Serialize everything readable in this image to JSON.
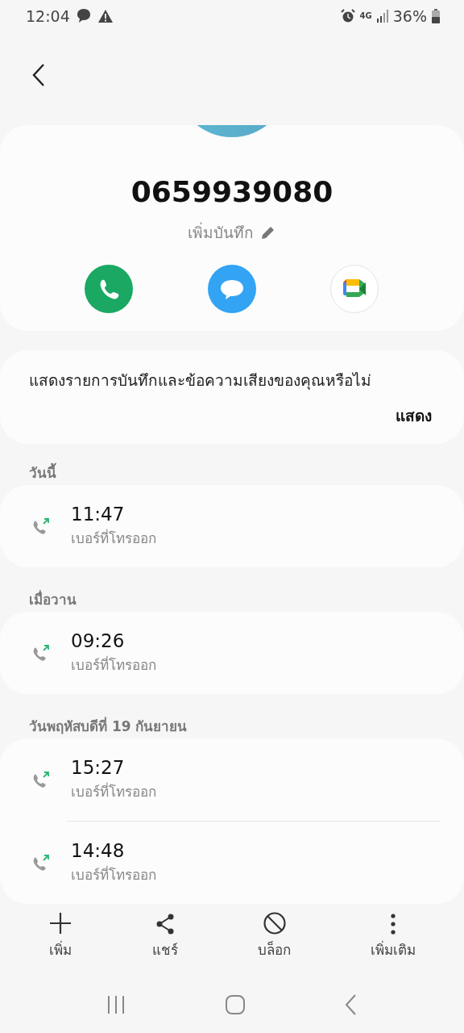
{
  "status_bar": {
    "time": "12:04",
    "network": "4G",
    "battery": "36%"
  },
  "contact": {
    "number": "0659939080",
    "note_placeholder": "เพิ่มบันทึก",
    "actions": [
      {
        "kind": "call"
      },
      {
        "kind": "message"
      },
      {
        "kind": "video"
      }
    ]
  },
  "banner": {
    "text": "แสดงรายการบันทึกและข้อความเสียงของคุณหรือไม่",
    "action": "แสดง"
  },
  "call_groups": [
    {
      "label": "วันนี้",
      "calls": [
        {
          "time": "11:47",
          "type": "เบอร์ที่โทรออก",
          "kind": "outgoing"
        }
      ]
    },
    {
      "label": "เมื่อวาน",
      "calls": [
        {
          "time": "09:26",
          "type": "เบอร์ที่โทรออก",
          "kind": "outgoing"
        }
      ]
    },
    {
      "label": "วันพฤหัสบดีที่ 19 กันยายน",
      "calls": [
        {
          "time": "15:27",
          "type": "เบอร์ที่โทรออก",
          "kind": "outgoing"
        },
        {
          "time": "14:48",
          "type": "เบอร์ที่โทรออก",
          "kind": "outgoing"
        }
      ]
    }
  ],
  "bottom_actions": [
    {
      "kind": "add",
      "label": "เพิ่ม"
    },
    {
      "kind": "share",
      "label": "แชร์"
    },
    {
      "kind": "block",
      "label": "บล็อก"
    },
    {
      "kind": "more",
      "label": "เพิ่มเติม"
    }
  ]
}
